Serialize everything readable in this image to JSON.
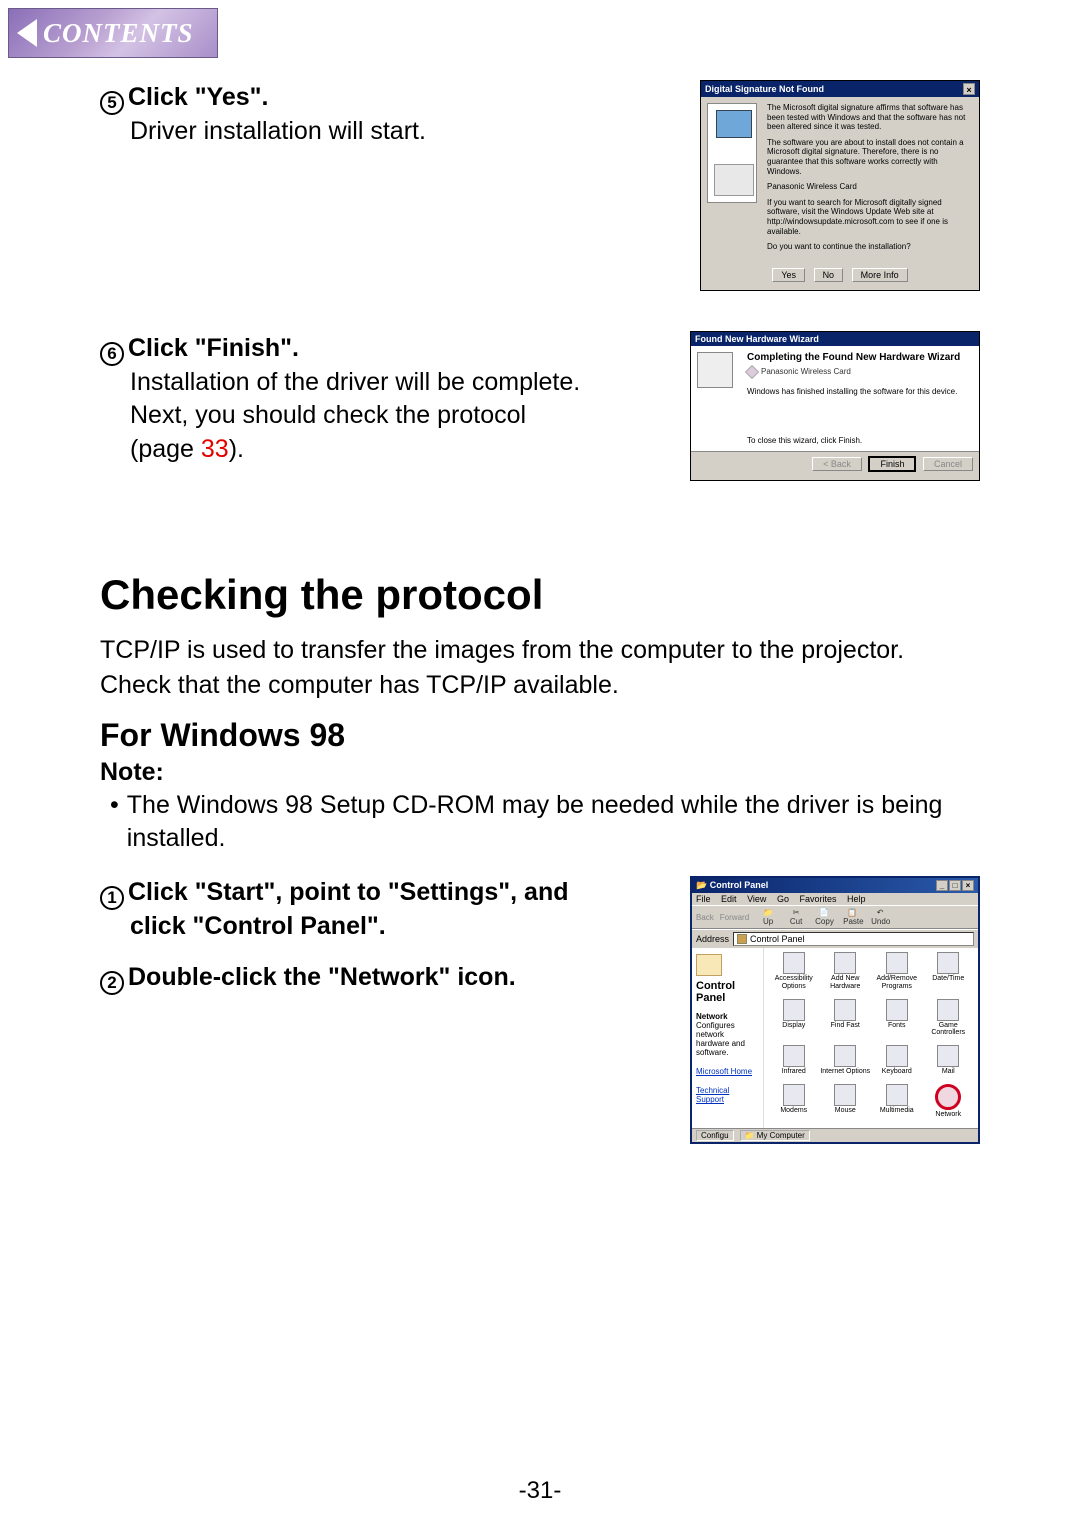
{
  "contents_tab": "CONTENTS",
  "step5": {
    "num": "5",
    "title": "Click \"Yes\".",
    "body": "Driver installation will start."
  },
  "step6": {
    "num": "6",
    "title": "Click \"Finish\".",
    "body1": "Installation of the driver will be complete.",
    "body2": "Next, you should check the protocol",
    "body3a": "(page ",
    "body3_page": "33",
    "body3b": ")."
  },
  "dlg1": {
    "title": "Digital Signature Not Found",
    "p1": "The Microsoft digital signature affirms that software has been tested with Windows and that the software has not been altered since it was tested.",
    "p2": "The software you are about to install does not contain a Microsoft digital signature. Therefore, there is no guarantee that this software works correctly with Windows.",
    "p3": "Panasonic Wireless Card",
    "p4": "If you want to search for Microsoft digitally signed software, visit the Windows Update Web site at http://windowsupdate.microsoft.com to see if one is available.",
    "p5": "Do you want to continue the installation?",
    "btn_yes": "Yes",
    "btn_no": "No",
    "btn_more": "More Info"
  },
  "dlg2": {
    "title": "Found New Hardware Wizard",
    "heading": "Completing the Found New Hardware Wizard",
    "device": "Panasonic Wireless Card",
    "msg": "Windows has finished installing the software for this device.",
    "close": "To close this wizard, click Finish.",
    "btn_back": "< Back",
    "btn_finish": "Finish",
    "btn_cancel": "Cancel"
  },
  "protocol_heading": "Checking the protocol",
  "protocol_para": "TCP/IP is used to transfer the images from the computer to the projector. Check that the computer has TCP/IP available.",
  "win98_heading": "For Windows 98",
  "note_label": "Note:",
  "note_body": "The Windows 98 Setup CD-ROM may be needed while the driver is being installed.",
  "step_w1": {
    "num": "1",
    "line1": "Click \"Start\", point to \"Settings\", and",
    "line2": "click \"Control Panel\"."
  },
  "step_w2": {
    "num": "2",
    "line": "Double-click the \"Network\" icon."
  },
  "cp": {
    "title": "Control Panel",
    "menu": {
      "file": "File",
      "edit": "Edit",
      "view": "View",
      "go": "Go",
      "fav": "Favorites",
      "help": "Help"
    },
    "tb_back": "Back",
    "tb_fwd": "Forward",
    "tb_up": "Up",
    "tb_cut": "Cut",
    "tb_copy": "Copy",
    "tb_paste": "Paste",
    "tb_undo": "Undo",
    "addr_label": "Address",
    "addr_val": "Control Panel",
    "side_title": "Control Panel",
    "side_sub_h": "Network",
    "side_sub": "Configures network hardware and software.",
    "side_l1": "Microsoft Home",
    "side_l2": "Technical Support",
    "icons": [
      "Accessibility Options",
      "Add New Hardware",
      "Add/Remove Programs",
      "Date/Time",
      "Display",
      "Find Fast",
      "Fonts",
      "Game Controllers",
      "Infrared",
      "Internet Options",
      "Keyboard",
      "Mail",
      "Modems",
      "Mouse",
      "Multimedia",
      "Network"
    ],
    "status1": "Configu",
    "status2": "My Computer"
  },
  "page_number": "-31-"
}
